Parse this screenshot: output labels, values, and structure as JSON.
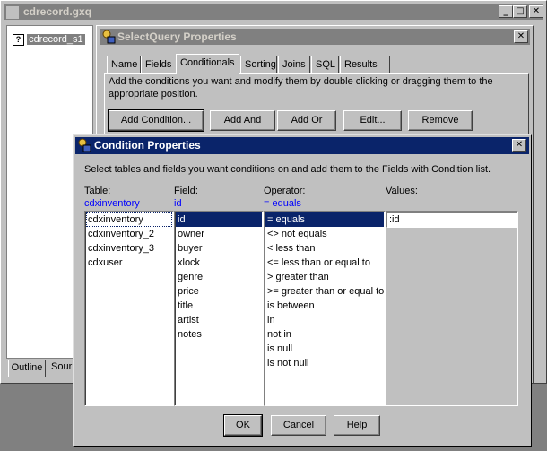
{
  "main_window": {
    "title": "cdrecord.gxq",
    "tree_item": "cdrecord_s1",
    "bottom_tabs": [
      "Outline",
      "Sour"
    ]
  },
  "selectquery": {
    "title": "SelectQuery Properties",
    "tabs": [
      "Name",
      "Fields",
      "Conditionals",
      "Sorting",
      "Joins",
      "SQL",
      "Results"
    ],
    "active_tab": "Conditionals",
    "instructions": "Add the conditions you want and modify them by double clicking or dragging them to the appropriate position.",
    "buttons": {
      "add_condition": "Add Condition...",
      "add_and": "Add And",
      "add_or": "Add Or",
      "edit": "Edit...",
      "remove": "Remove"
    }
  },
  "condition_dialog": {
    "title": "Condition Properties",
    "instructions": "Select tables and fields you want conditions on and add them to the Fields with Condition list.",
    "table": {
      "label": "Table:",
      "current": "cdxinventory",
      "items": [
        "cdxinventory",
        "cdxinventory_2",
        "cdxinventory_3",
        "cdxuser"
      ],
      "selected": 0
    },
    "field": {
      "label": "Field:",
      "current": "id",
      "items": [
        "id",
        "owner",
        "buyer",
        "xlock",
        "genre",
        "price",
        "title",
        "artist",
        "notes"
      ],
      "selected": 0
    },
    "operator": {
      "label": "Operator:",
      "current": "= equals",
      "items": [
        "= equals",
        "<> not equals",
        "< less than",
        "<= less than or equal to",
        "> greater than",
        ">= greater than or equal to",
        "is between",
        "in",
        "not in",
        "is null",
        "is not null"
      ],
      "selected": 0
    },
    "values": {
      "label": "Values:",
      "value": ":id"
    },
    "buttons": {
      "ok": "OK",
      "cancel": "Cancel",
      "help": "Help"
    }
  },
  "window_buttons": {
    "minimize": "_",
    "maximize": "□",
    "close": "✕"
  }
}
